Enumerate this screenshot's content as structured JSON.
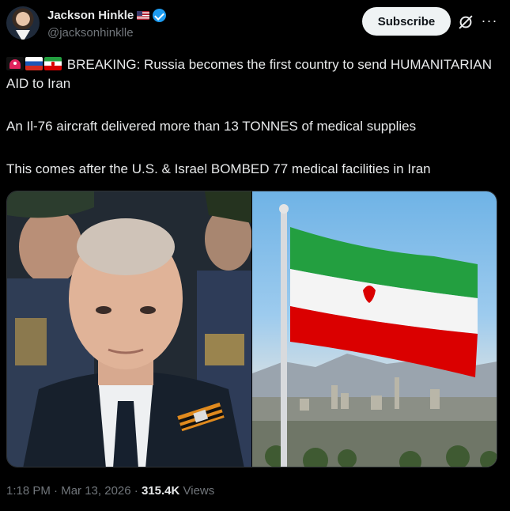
{
  "author": {
    "display_name": "Jackson Hinkle",
    "handle": "@jacksonhinklle",
    "flag_icon": "us-flag-icon",
    "verified_icon": "verified-badge-icon"
  },
  "header": {
    "subscribe_label": "Subscribe",
    "grok_icon": "grok-icon",
    "more_icon": "more-icon"
  },
  "tweet": {
    "line1_emoji": [
      "siren-emoji",
      "russia-flag-emoji",
      "iran-flag-emoji"
    ],
    "line1": "BREAKING: Russia becomes the first country to send HUMANITARIAN AID to Iran",
    "line2": "An Il-76 aircraft delivered more than 13 TONNES of medical supplies",
    "line3": "This comes after the U.S. & Israel BOMBED 77 medical facilities in Iran"
  },
  "media": {
    "left": "photo of Putin in dark suit with St. George ribbon, military officers behind",
    "right": "Iranian flag on pole over city skyline with mountains"
  },
  "meta": {
    "time": "1:18 PM",
    "date": "Mar 13, 2026",
    "separator": "·",
    "views_count": "315.4K",
    "views_label": "Views"
  },
  "colors": {
    "background": "#000000",
    "text": "#e7e9ea",
    "secondary": "#71767b",
    "verified": "#1d9bf0"
  }
}
